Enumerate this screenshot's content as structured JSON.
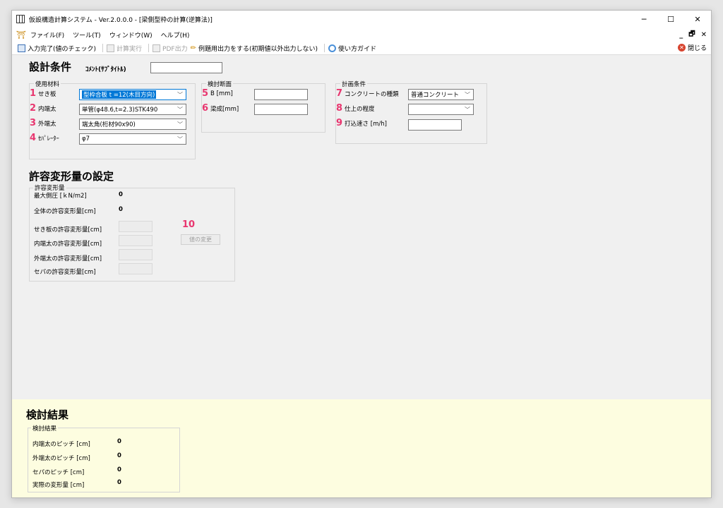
{
  "window": {
    "title": "仮設構造計算システム - Ver.2.0.0.0 - [梁側型枠の計算(逆算法)]",
    "controls": {
      "minimize": "─",
      "maximize": "☐",
      "close": "✕"
    }
  },
  "menu": {
    "items": [
      "ファイル(F)",
      "ツール(T)",
      "ウィンドウ(W)",
      "ヘルプ(H)"
    ],
    "mdi": {
      "minimize": "_",
      "restore": "🗗",
      "close": "✕"
    }
  },
  "toolbar": {
    "input_complete": "入力完了(値のチェック)",
    "calculate": "計算実行",
    "pdf": "PDF出力",
    "example_output": "例題用出力をする(初期値以外出力しない)",
    "guide": "使い方ガイド",
    "close": "閉じる"
  },
  "design_conditions": {
    "heading": "設計条件",
    "comment_label": "ｺﾒﾝﾄ(ｻﾌﾞﾀｲﾄﾙ)",
    "comment_value": ""
  },
  "materials": {
    "group_label": "使用材料",
    "rows": [
      {
        "num": "1",
        "label": "せき板",
        "value": "型枠合板 t =12(木目方向)"
      },
      {
        "num": "2",
        "label": "内端太",
        "value": "単管(φ48.6,t=2.3)STK490"
      },
      {
        "num": "3",
        "label": "外端太",
        "value": "端太角(桁材90x90)"
      },
      {
        "num": "4",
        "label": "ｾﾊﾟﾚｰﾀｰ",
        "value": "φ7"
      }
    ]
  },
  "section": {
    "group_label": "検討断面",
    "rows": [
      {
        "num": "5",
        "label": "B [mm]",
        "value": ""
      },
      {
        "num": "6",
        "label": "梁成[mm]",
        "value": ""
      }
    ]
  },
  "plan": {
    "group_label": "計画条件",
    "rows": [
      {
        "num": "7",
        "label": "コンクリートの種類",
        "value": "普通コンクリート"
      },
      {
        "num": "8",
        "label": "仕上の程度",
        "value": ""
      },
      {
        "num": "9",
        "label": "打込速さ [m/h]",
        "value": ""
      }
    ]
  },
  "allowable": {
    "heading": "許容変形量の設定",
    "group_label": "許容変形量",
    "max_pressure_label": "最大側圧 [ｋN/m2]",
    "max_pressure_value": "0",
    "total_label": "全体の許容変形量[cm]",
    "total_value": "0",
    "items": [
      "せき板の許容変形量[cm]",
      "内端太の許容変形量[cm]",
      "外端太の許容変形量[cm]",
      "セパの許容変形量[cm]"
    ],
    "num": "10",
    "change_button": "値の変更"
  },
  "results": {
    "heading": "検討結果",
    "group_label": "検討結果",
    "rows": [
      {
        "label": "内端太のピッチ [cm]",
        "value": "0"
      },
      {
        "label": "外端太のピッチ [cm]",
        "value": "0"
      },
      {
        "label": "セパのピッチ [cm]",
        "value": "0"
      },
      {
        "label": "実際の変形量 [cm]",
        "value": "0"
      }
    ]
  },
  "colors": {
    "accent_number": "#e8366f",
    "results_bg": "#fdfde0",
    "focus_blue": "#0078d7"
  }
}
